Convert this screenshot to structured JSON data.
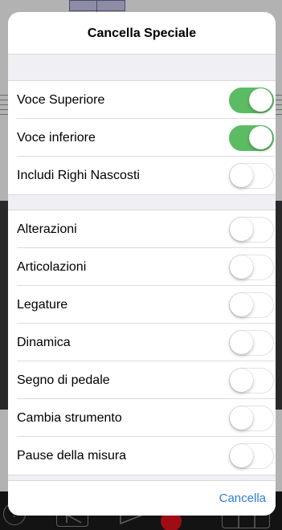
{
  "dialog": {
    "title": "Cancella Speciale",
    "cancel_label": "Cancella"
  },
  "groups": [
    {
      "options": [
        {
          "label": "Voce Superiore",
          "checked": true
        },
        {
          "label": "Voce inferiore",
          "checked": true
        },
        {
          "label": "Includi Righi Nascosti",
          "checked": false
        }
      ]
    },
    {
      "options": [
        {
          "label": "Alterazioni",
          "checked": false
        },
        {
          "label": "Articolazioni",
          "checked": false
        },
        {
          "label": "Legature",
          "checked": false
        },
        {
          "label": "Dinamica",
          "checked": false
        },
        {
          "label": "Segno di pedale",
          "checked": false
        },
        {
          "label": "Cambia strumento",
          "checked": false
        },
        {
          "label": "Pause della misura",
          "checked": false
        }
      ]
    }
  ],
  "colors": {
    "toggle_on": "#5cbc63",
    "accent": "#2e7dd7"
  },
  "toolbar": {
    "help_glyph": "?"
  }
}
